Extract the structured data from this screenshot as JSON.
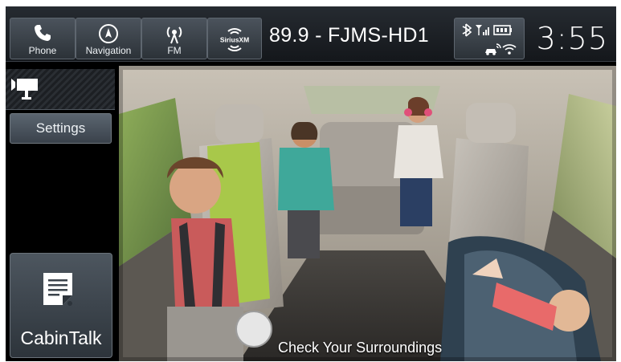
{
  "topbar": {
    "tiles": [
      {
        "label": "Phone",
        "icon": "phone-icon"
      },
      {
        "label": "Navigation",
        "icon": "compass-icon"
      },
      {
        "label": "FM",
        "icon": "radio-icon"
      },
      {
        "label": "",
        "icon": "siriusxm-logo",
        "logo_text": "SiriusXM"
      }
    ],
    "station": "89.9 - FJMS-HD1",
    "status_icons": [
      "bluetooth-icon",
      "signal-icon",
      "battery-icon",
      "car-wifi-icon",
      "wifi-icon"
    ],
    "clock": "3:55"
  },
  "sidebar": {
    "camera_icon": "camera-icon",
    "settings_label": "Settings",
    "cabintalk_label": "CabinTalk",
    "cabintalk_icon": "notepad-icon"
  },
  "camera_view": {
    "overlay": "Check Your Surroundings"
  },
  "colors": {
    "bar_dark": "#14171b",
    "tile_top": "#4b535c",
    "accent_white": "#ffffff"
  }
}
